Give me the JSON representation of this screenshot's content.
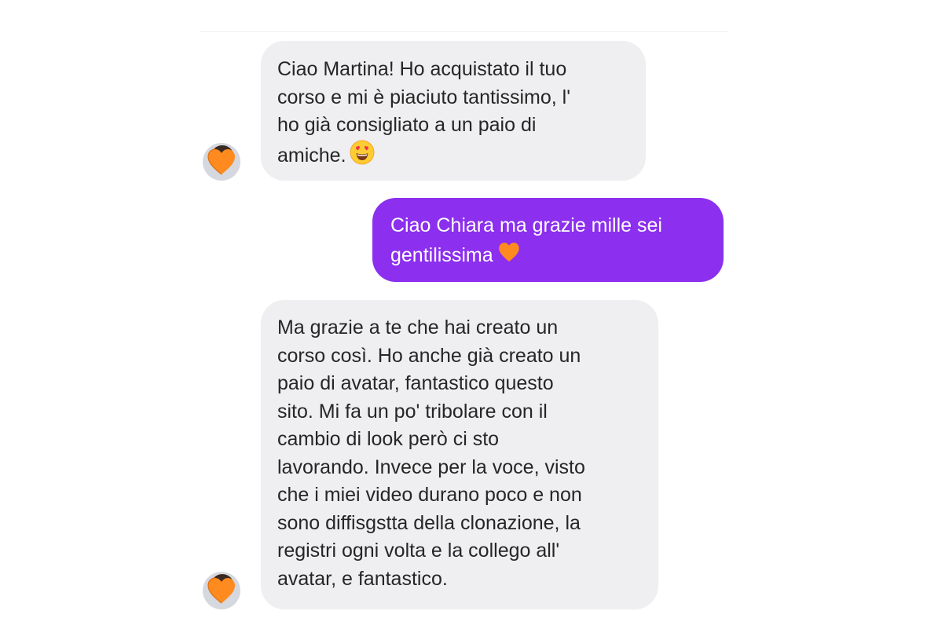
{
  "conversation": {
    "messages": [
      {
        "sender": "incoming",
        "lines": [
          "Ciao Martina! Ho acquistato il tuo",
          "corso e mi è piaciuto tantissimo, l'",
          "ho già consigliato a un paio di",
          "amiche."
        ],
        "emoji": "heart-eyes-emoji"
      },
      {
        "sender": "outgoing",
        "lines": [
          "Ciao Chiara ma grazie mille sei",
          "gentilissima"
        ],
        "emoji": "orange-heart-emoji"
      },
      {
        "sender": "incoming",
        "lines": [
          "Ma grazie a te che hai creato un",
          "corso così. Ho anche già creato un",
          "paio di avatar, fantastico questo",
          "sito. Mi fa un po' tribolare con il",
          "cambio di look però ci sto",
          "lavorando. Invece per la voce, visto",
          "che i miei video durano poco e non",
          "sono diffisgstta della clonazione, la",
          "registri ogni volta e la collego all'",
          "avatar, e fantastico."
        ]
      }
    ],
    "avatar_icon": "orange-heart-avatar-icon"
  },
  "colors": {
    "incoming_bubble": "#efeff1",
    "outgoing_bubble": "#8c2fee",
    "outgoing_text": "#ffffff",
    "incoming_text": "#262626",
    "heart": "#ff8a1f"
  }
}
